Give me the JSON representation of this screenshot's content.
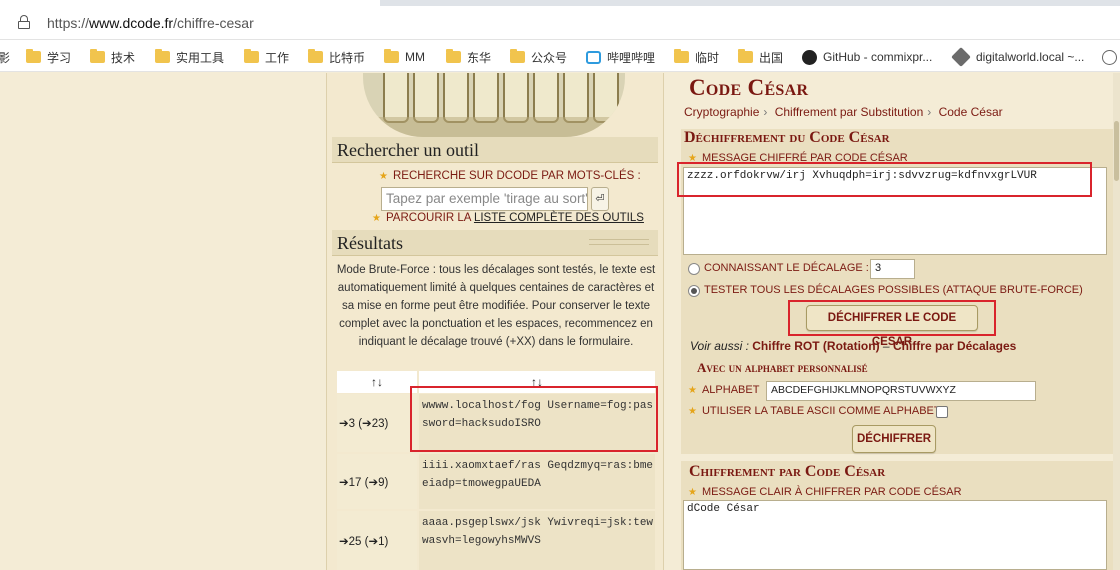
{
  "browser": {
    "url_prefix": "https://",
    "url_domain": "www.dcode.fr",
    "url_path": "/chiffre-cesar"
  },
  "bookmarks": [
    {
      "label": "影",
      "icon": "folder-icon"
    },
    {
      "label": "学习",
      "icon": "folder-icon"
    },
    {
      "label": "技术",
      "icon": "folder-icon"
    },
    {
      "label": "实用工具",
      "icon": "folder-icon"
    },
    {
      "label": "工作",
      "icon": "folder-icon"
    },
    {
      "label": "比特币",
      "icon": "folder-icon"
    },
    {
      "label": "MM",
      "icon": "folder-icon"
    },
    {
      "label": "东华",
      "icon": "folder-icon"
    },
    {
      "label": "公众号",
      "icon": "folder-icon"
    },
    {
      "label": "哔哩哔哩",
      "icon": "bilibili-icon"
    },
    {
      "label": "临时",
      "icon": "folder-icon"
    },
    {
      "label": "出国",
      "icon": "folder-icon"
    },
    {
      "label": "GitHub - commixpr...",
      "icon": "github-icon"
    },
    {
      "label": "digitalworld.local ~...",
      "icon": "diamond-icon"
    }
  ],
  "left": {
    "search_title": "Rechercher un outil",
    "keyword_label": "RECHERCHE SUR DCODE PAR MOTS-CLÉS :",
    "search_placeholder": "Tapez par exemple 'tirage au sort'",
    "search_button": "⏎",
    "browse_prefix": "PARCOURIR LA",
    "browse_link": "LISTE COMPLÈTE DES OUTILS",
    "results_title": "Résultats",
    "brute_force_text": "Mode Brute-Force : tous les décalages sont testés, le texte est automatiquement limité à quelques centaines de caractères et sa mise en forme peut être modifiée. Pour conserver le texte complet avec la ponctuation et les espaces, recommencez en indiquant le décalage trouvé (+XX) dans le formulaire.",
    "col_shift_header": "↑↓",
    "col_result_header": "↑↓",
    "rows": [
      {
        "shift": "➔3 (➔23)",
        "result": "wwww.localhost/fog Username=fog:password=hacksudoISRO"
      },
      {
        "shift": "➔17 (➔9)",
        "result": "iiii.xaomxtaef/ras Geqdzmyq=ras:bmeeiadp=tmowegpaUEDA"
      },
      {
        "shift": "➔25 (➔1)",
        "result": "aaaa.psgeplswx/jsk Ywivreqi=jsk:tewwasvh=legowyhsMWVS"
      }
    ]
  },
  "right": {
    "title": "Code César",
    "breadcrumb": [
      "Cryptographie",
      "Chiffrement par Substitution",
      "Code César"
    ],
    "decrypt_title": "Déchiffrement du Code César",
    "cipher_label": "MESSAGE CHIFFRÉ PAR CODE CÉSAR",
    "cipher_value": "zzzz.orfdokrvw/irj Xvhuqdph=irj:sdvvzrug=kdfnvxgrLVUR",
    "known_shift_label": "CONNAISSANT LE DÉCALAGE :",
    "shift_value": "3",
    "brute_label": "TESTER TOUS LES DÉCALAGES POSSIBLES (ATTAQUE BRUTE-FORCE)",
    "decrypt_button": "DÉCHIFFRER LE CODE CÉSAR",
    "see_also_prefix": "Voir aussi :",
    "see_also_1": "Chiffre ROT (Rotation)",
    "see_also_sep": "–",
    "see_also_2": "Chiffre par Décalages",
    "alphabet_title": "Avec un alphabet personnalisé",
    "alphabet_label": "ALPHABET",
    "alphabet_value": "ABCDEFGHIJKLMNOPQRSTUVWXYZ",
    "ascii_label": "UTILISER LA TABLE ASCII COMME ALPHABET",
    "decrypt_button_2": "DÉCHIFFRER",
    "encrypt_title": "Chiffrement par Code César",
    "plain_label": "MESSAGE CLAIR À CHIFFRER PAR CODE CÉSAR",
    "plain_value": "dCode César"
  }
}
